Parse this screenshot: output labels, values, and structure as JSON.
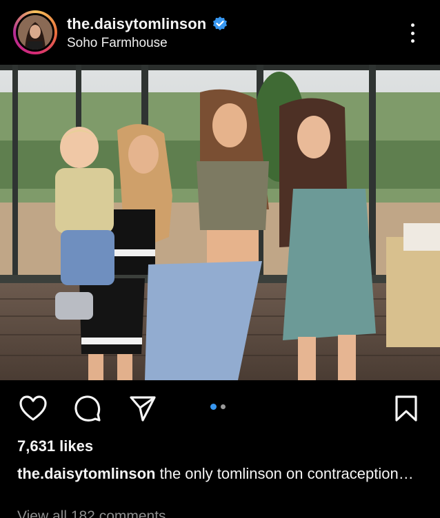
{
  "post": {
    "username": "the.daisytomlinson",
    "location": "Soho Farmhouse",
    "verified": true,
    "likes": "7,631 likes",
    "caption_user": "the.daisytomlinson",
    "caption_text": " the only tomlinson on contraception…",
    "view_comments": "View all 182 comments",
    "carousel": {
      "current": 1,
      "total": 2
    }
  },
  "icons": {
    "verified": "verified-badge-icon",
    "more": "more-options-icon",
    "like": "heart-icon",
    "comment": "comment-icon",
    "share": "paper-plane-icon",
    "save": "bookmark-icon"
  },
  "colors": {
    "background": "#000000",
    "text": "#f5f5f5",
    "verified": "#3897f0",
    "carousel_active": "#3897f0",
    "carousel_inactive": "#9a9a9a"
  }
}
